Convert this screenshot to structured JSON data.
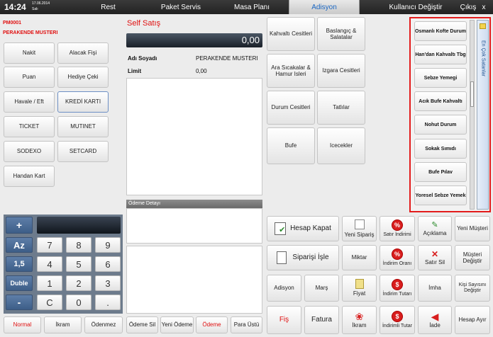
{
  "header": {
    "time": "14:24",
    "date": "17.06.2014",
    "day": "Salı",
    "tabs": [
      "Rest",
      "Paket Servis",
      "Masa Planı",
      "Adisyon"
    ],
    "user_change": "Kullanıcı Değiştir",
    "exit": "Çıkış",
    "close": "x"
  },
  "customer": {
    "code": "PM0001",
    "name": "PERAKENDE MUSTERI"
  },
  "payment_methods": [
    "Nakit",
    "Alacak Fişi",
    "Puan",
    "Hediye Çeki",
    "Havale / Eft",
    "KREDİ KARTI",
    "TICKET",
    "MUTINET",
    "SODEXO",
    "SETCARD",
    "Handan Kart"
  ],
  "self_service": {
    "title": "Self Satış",
    "amount": "0,00",
    "name_label": "Adı Soyadı",
    "name_value": "PERAKENDE MUSTERI",
    "limit_label": "Limit",
    "limit_value": "0,00",
    "payment_detail_label": "Ödeme Detayı"
  },
  "keypad": {
    "plus": "+",
    "az": "Az",
    "qty": "1,5",
    "double": "Duble",
    "minus": "-",
    "digits": [
      "7",
      "8",
      "9",
      "4",
      "5",
      "6",
      "1",
      "2",
      "3",
      "C",
      "0",
      "."
    ],
    "normal": "Normal",
    "ikram": "İkram",
    "odenmez": "Ödenmez"
  },
  "payment_actions": [
    "Ödeme Sil",
    "Yeni Ödeme",
    "Ödeme",
    "Para Üstü"
  ],
  "categories": [
    "Kahvaltı Cesitleri",
    "Baslangıç & Salatalar",
    "Ara Sıcakalar & Hamur Isleri",
    "Izgara Cesitleri",
    "Durum Cesitleri",
    "Tatlılar",
    "Bufe",
    "Icecekler"
  ],
  "best_sellers": {
    "label": "En Çok Satanlar",
    "items": [
      "Osmanlı Kofte Durum",
      "Han'dan Kahvaltı Tbg",
      "Sebze Yemegi",
      "Acık Bufe Kahvaltı",
      "Nohut Durum",
      "Sokak Sımıdı",
      "Bufe Pılav",
      "Yoresel Sebze Yemek"
    ]
  },
  "actions": {
    "hesap_kapat": "Hesap Kapat",
    "yeni_siparis": "Yeni Sipariş",
    "satir_indirimi": "Satır İndirimi",
    "aciklama": "Açıklama",
    "yeni_musteri": "Yeni Müşteri",
    "siparisi_isle": "Siparişi İşle",
    "miktar": "Miktar",
    "indirim_orani": "İndirim Oranı",
    "satir_sil": "Satır Sil",
    "musteri_degistir": "Müşteri Değiştir",
    "adisyon": "Adisyon",
    "mars": "Marş",
    "fiyat": "Fiyat",
    "indirim_tutari": "İndirim Tutarı",
    "imha": "İmha",
    "kisi_sayisi": "Kişi Sayısını Değiştir",
    "fis": "Fiş",
    "fatura": "Fatura",
    "ikram": "İkram",
    "indirimli_tutar": "İndirimli Tutar",
    "iade": "İade",
    "hesap_ayir": "Hesap Ayır"
  },
  "colors": {
    "accent_red": "#e01010",
    "highlight_border": "#e31b1b",
    "active_tab": "#1a66c2"
  }
}
